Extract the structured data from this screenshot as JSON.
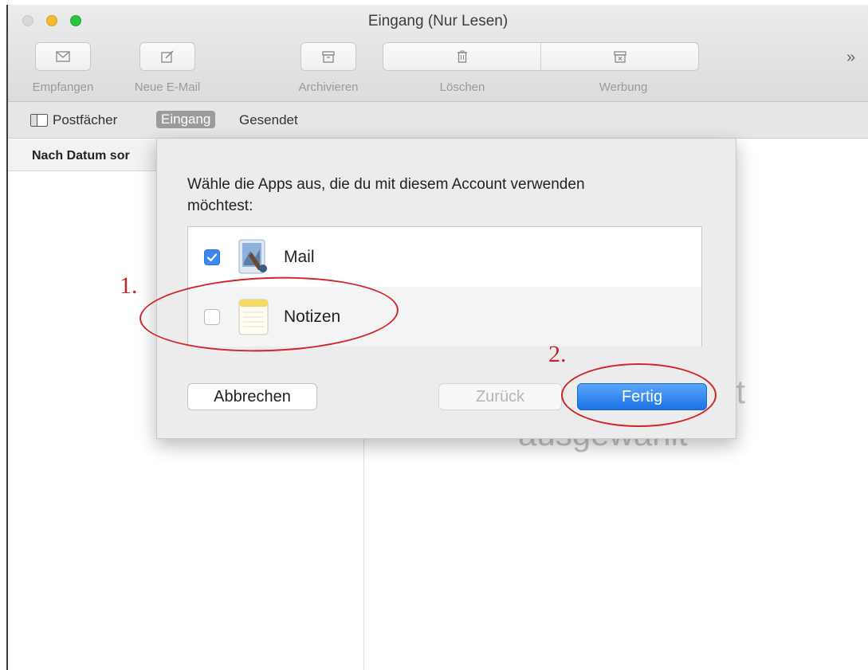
{
  "window": {
    "title": "Eingang (Nur Lesen)"
  },
  "toolbar": {
    "receive_label": "Empfangen",
    "compose_label": "Neue E-Mail",
    "archive_label": "Archivieren",
    "delete_label": "Löschen",
    "junk_label": "Werbung",
    "overflow": "»"
  },
  "favorites": {
    "mailboxes_label": "Postfächer",
    "inbox_label": "Eingang",
    "sent_label": "Gesendet"
  },
  "message_list": {
    "sort_header": "Nach Datum sor"
  },
  "content": {
    "empty_line1": "nt",
    "empty_line2": "ausgewählt"
  },
  "dialog": {
    "prompt": "Wähle die Apps aus, die du mit diesem Account verwenden möchtest:",
    "apps": [
      {
        "name": "Mail",
        "checked": true,
        "icon": "mail-app-icon"
      },
      {
        "name": "Notizen",
        "checked": false,
        "icon": "notes-app-icon"
      }
    ],
    "cancel_label": "Abbrechen",
    "back_label": "Zurück",
    "done_label": "Fertig"
  },
  "annotations": {
    "step1": "1.",
    "step2": "2."
  },
  "colors": {
    "annotation": "#d2252a",
    "primary_button": "#2a7fec",
    "checkbox": "#3b88f0"
  }
}
